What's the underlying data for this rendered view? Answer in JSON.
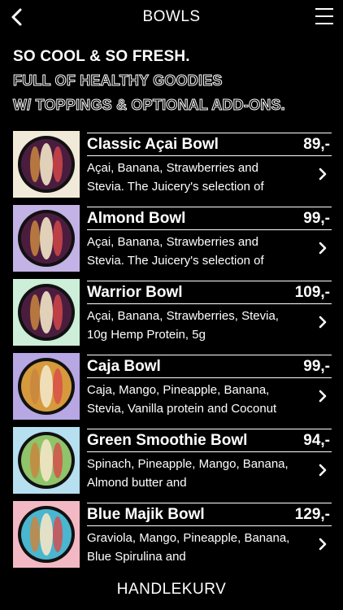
{
  "header": {
    "title": "BOWLS",
    "back_icon": "chevron-left-icon",
    "menu_icon": "hamburger-menu-icon"
  },
  "hero": {
    "line1": "SO COOL & SO FRESH.",
    "line2": "FULL OF HEALTHY GOODIES",
    "line3": "W/ TOPPINGS & OPTIONAL ADD-ONS."
  },
  "items": [
    {
      "name": "Classic Açai Bowl",
      "price": "89,-",
      "desc": "Açai, Banana, Strawberries and Stevia. The Juicery's selection of",
      "bg": "#f1ead9",
      "bowl": "#4a1d3f"
    },
    {
      "name": "Almond Bowl",
      "price": "99,-",
      "desc": "Açai, Banana, Strawberries and Stevia. The Juicery's selection of",
      "bg": "#c3b2e6",
      "bowl": "#4a1d3f"
    },
    {
      "name": "Warrior Bowl",
      "price": "109,-",
      "desc": "Açai, Banana, Strawberries, Stevia, 10g Hemp Protein, 5g",
      "bg": "#cdeed9",
      "bowl": "#4a1d3f"
    },
    {
      "name": "Caja Bowl",
      "price": "99,-",
      "desc": "Caja, Mango, Pineapple, Banana, Stevia, Vanilla protein and Coconut",
      "bg": "#b7a7e3",
      "bowl": "#d69a3c"
    },
    {
      "name": "Green Smoothie Bowl",
      "price": "94,-",
      "desc": "Spinach, Pineapple, Mango, Banana, Almond butter and",
      "bg": "#b6dff0",
      "bowl": "#8fc46a"
    },
    {
      "name": "Blue Majik Bowl",
      "price": "129,-",
      "desc": "Graviola, Mango, Pineapple, Banana, Blue Spirulina and",
      "bg": "#f2b9c4",
      "bowl": "#4ab6cf"
    }
  ],
  "cart": {
    "label": "HANDLEKURV"
  }
}
